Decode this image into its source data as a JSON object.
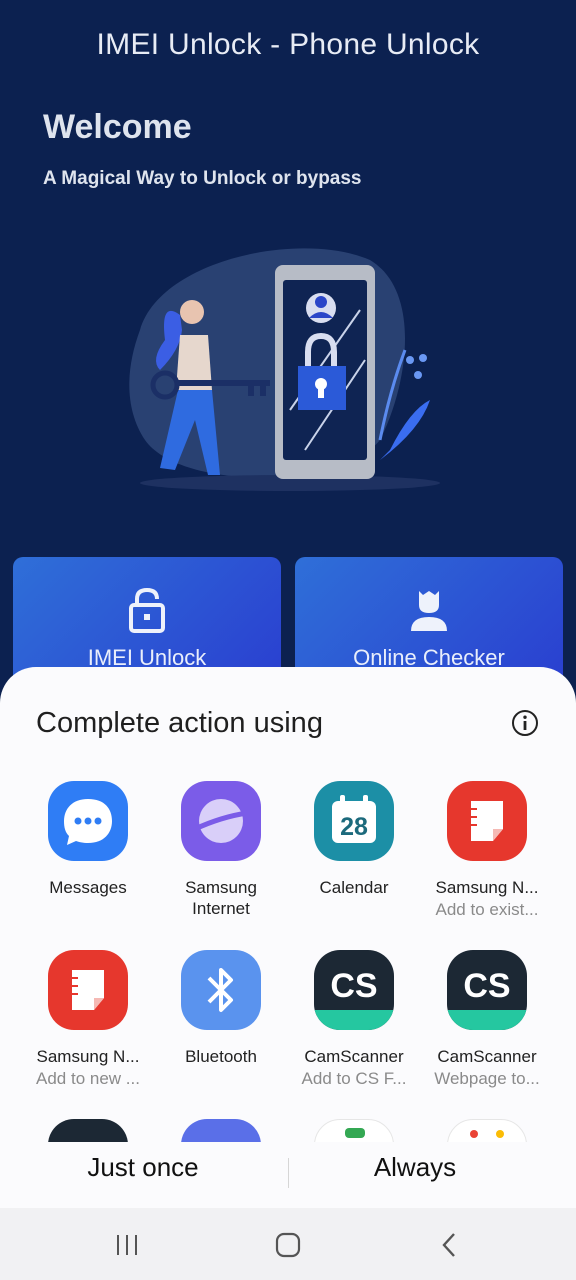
{
  "app": {
    "title": "IMEI Unlock - Phone Unlock",
    "welcome": "Welcome",
    "tagline": "A Magical Way to Unlock or bypass",
    "tiles": [
      {
        "label": "IMEI Unlock",
        "icon": "lock-icon"
      },
      {
        "label": "Online Checker",
        "icon": "user-icon"
      }
    ]
  },
  "sheet": {
    "title": "Complete action using",
    "info_icon": "info-icon",
    "apps": [
      {
        "name": "Messages",
        "sub": "",
        "icon": "messages-icon",
        "color": "#2f7df5"
      },
      {
        "name": "Samsung",
        "name2": "Internet",
        "sub": "",
        "icon": "samsung-internet-icon",
        "color": "#7b5ce8"
      },
      {
        "name": "Calendar",
        "sub": "",
        "icon": "calendar-icon",
        "color": "#1c8fa6",
        "date": "28"
      },
      {
        "name": "Samsung N...",
        "sub": "Add to exist...",
        "icon": "samsung-notes-icon",
        "color": "#e6372d"
      },
      {
        "name": "Samsung N...",
        "sub": "Add to new ...",
        "icon": "samsung-notes-icon",
        "color": "#e6372d"
      },
      {
        "name": "Bluetooth",
        "sub": "",
        "icon": "bluetooth-icon",
        "color": "#5a93ee"
      },
      {
        "name": "CamScanner",
        "sub": "Add to CS F...",
        "icon": "camscanner-icon",
        "color": "#1c2834",
        "text": "CS"
      },
      {
        "name": "CamScanner",
        "sub": "Webpage to...",
        "icon": "camscanner-icon",
        "color": "#1c2834",
        "text": "CS"
      }
    ],
    "just_once": "Just once",
    "always": "Always"
  },
  "navbar": {
    "recents": "recents-icon",
    "home": "home-icon",
    "back": "back-icon"
  }
}
